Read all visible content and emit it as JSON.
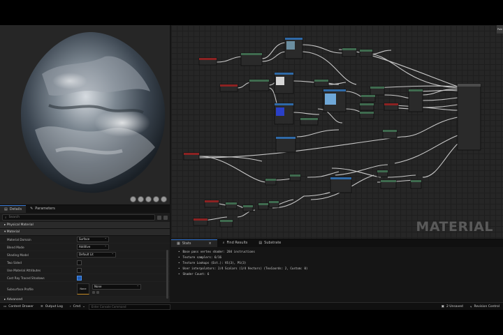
{
  "details_panel": {
    "tabs": [
      {
        "label": "Details"
      },
      {
        "label": "Parameters"
      }
    ],
    "search_placeholder": "Search",
    "categories": {
      "physical_material": "Physical Material",
      "material": "Material",
      "advanced": "Advanced"
    },
    "properties": {
      "material_domain": {
        "label": "Material Domain",
        "value": "Surface"
      },
      "blend_mode": {
        "label": "Blend Mode",
        "value": "Additive"
      },
      "shading_model": {
        "label": "Shading Model",
        "value": "Default Lit"
      },
      "two_sided": {
        "label": "Two Sided"
      },
      "use_material_attributes": {
        "label": "Use Material Attributes"
      },
      "cast_ray_traced_shadows": {
        "label": "Cast Ray Traced Shadows"
      },
      "subsurface_profile": {
        "label": "Subsurface Profile",
        "value": "None",
        "asset_label": "None"
      }
    }
  },
  "graph": {
    "watermark": "MATERIAL",
    "side_tab": "Pale"
  },
  "stats_panel": {
    "tabs": [
      {
        "label": "Stats"
      },
      {
        "label": "Find Results"
      },
      {
        "label": "Substrate"
      }
    ],
    "lines": [
      "Base pass vertex shader: 284 instructions",
      "Texture samplers: 6/16",
      "Texture Lookups (Est.): VS(3), PS(3)",
      "User interpolators: 2/4 Scalars (1/4 Vectors) (TexCoords: 2, Custom: 0)",
      "Shader Count: 6"
    ]
  },
  "status_bar": {
    "content_drawer": "Content Drawer",
    "output_log": "Output Log",
    "cmd": "Cmd",
    "console_placeholder": "Enter Console Command",
    "unsaved": "2 Unsaved",
    "revision_control": "Revision Control"
  },
  "colors": {
    "accent": "#3a7bd5",
    "graph_bg": "#262626",
    "panel_bg": "#1c1c1c"
  }
}
